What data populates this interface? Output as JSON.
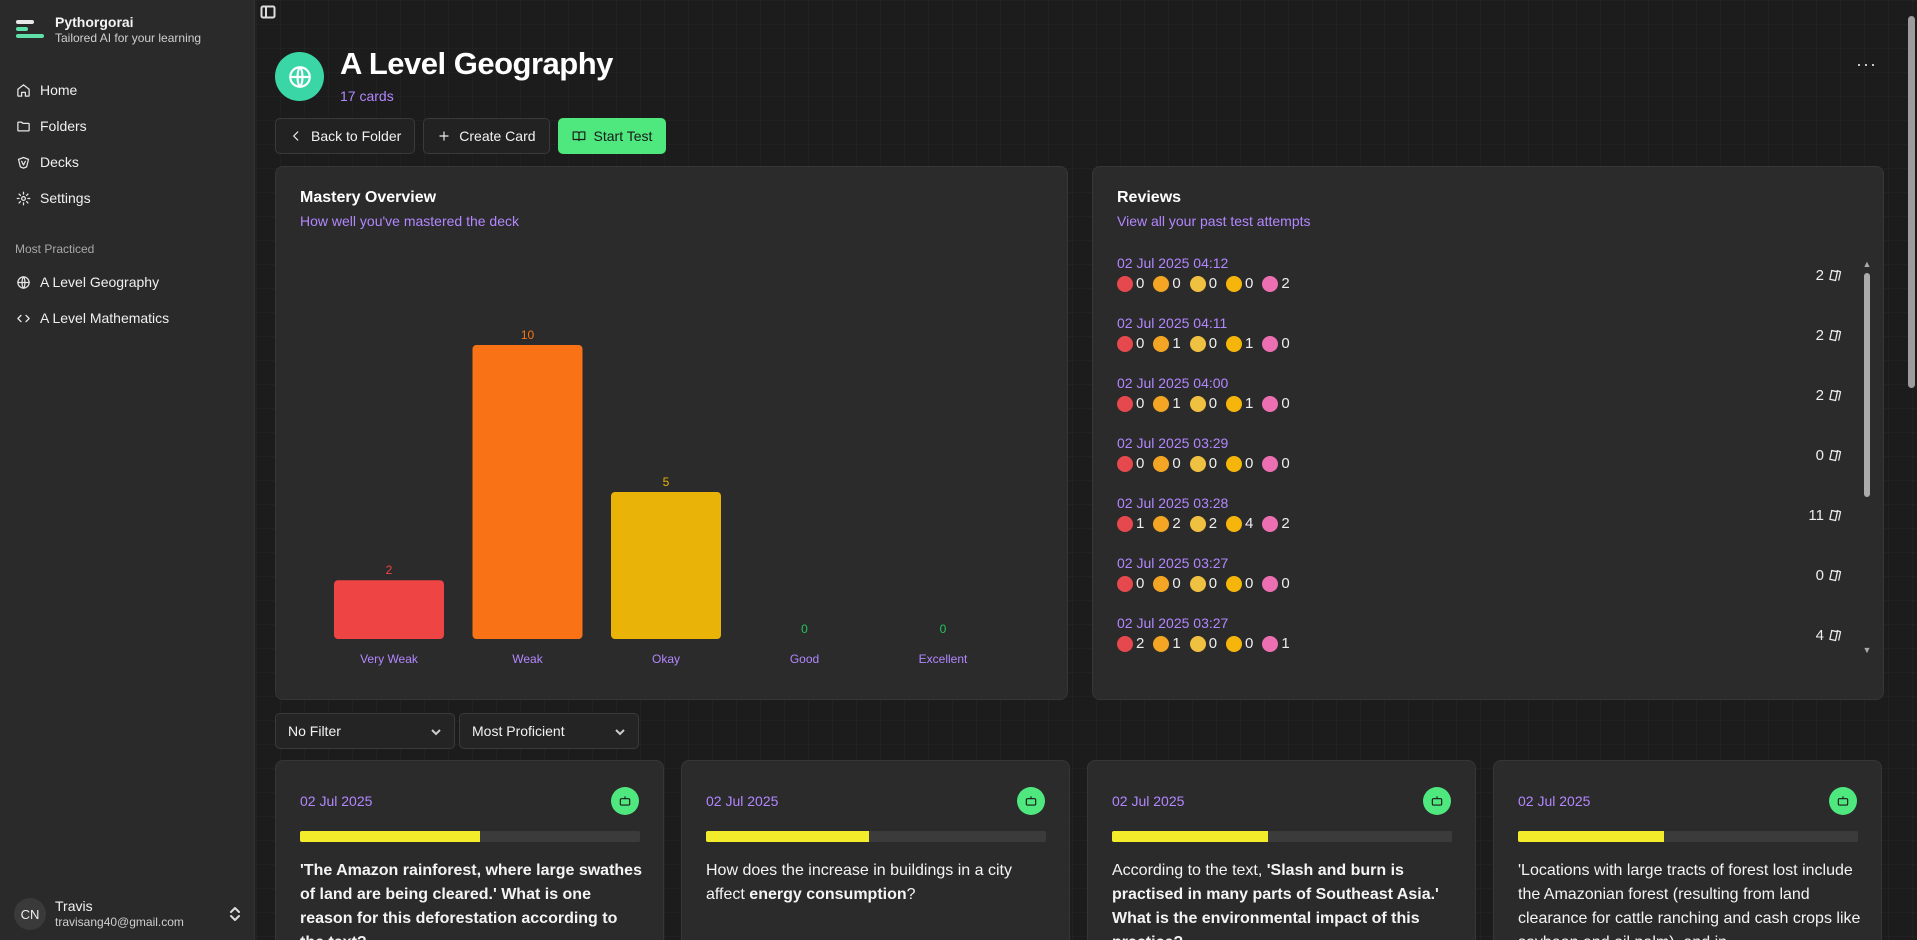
{
  "brand": {
    "name": "Pythorgorai",
    "tagline": "Tailored AI for your learning"
  },
  "nav": [
    {
      "label": "Home",
      "icon": "home-icon"
    },
    {
      "label": "Folders",
      "icon": "folder-icon"
    },
    {
      "label": "Decks",
      "icon": "decks-icon"
    },
    {
      "label": "Settings",
      "icon": "gear-icon"
    }
  ],
  "most_practiced": {
    "label": "Most Practiced",
    "items": [
      {
        "label": "A Level Geography",
        "icon": "globe-icon"
      },
      {
        "label": "A Level Mathematics",
        "icon": "code-icon"
      }
    ]
  },
  "user": {
    "initials": "CN",
    "name": "Travis",
    "email": "travisang40@gmail.com"
  },
  "header": {
    "title": "A Level Geography",
    "subtitle": "17 cards",
    "more": "···"
  },
  "actions": {
    "back": "Back to Folder",
    "create": "Create Card",
    "start": "Start Test"
  },
  "mastery": {
    "title": "Mastery Overview",
    "subtitle": "How well you've mastered the deck"
  },
  "chart_data": {
    "type": "bar",
    "categories": [
      "Very Weak",
      "Weak",
      "Okay",
      "Good",
      "Excellent"
    ],
    "values": [
      2,
      10,
      5,
      0,
      0
    ],
    "colors": [
      "#ef4444",
      "#f97316",
      "#eab308",
      "#22c55e",
      "#22c55e"
    ],
    "ylim": [
      0,
      10
    ]
  },
  "reviews": {
    "title": "Reviews",
    "subtitle": "View all your past test attempts",
    "items": [
      {
        "date": "02 Jul 2025 04:12",
        "counts": [
          0,
          0,
          0,
          0,
          2
        ],
        "total": "2"
      },
      {
        "date": "02 Jul 2025 04:11",
        "counts": [
          0,
          1,
          0,
          1,
          0
        ],
        "total": "2"
      },
      {
        "date": "02 Jul 2025 04:00",
        "counts": [
          0,
          1,
          0,
          1,
          0
        ],
        "total": "2"
      },
      {
        "date": "02 Jul 2025 03:29",
        "counts": [
          0,
          0,
          0,
          0,
          0
        ],
        "total": "0"
      },
      {
        "date": "02 Jul 2025 03:28",
        "counts": [
          1,
          2,
          2,
          4,
          2
        ],
        "total": "11"
      },
      {
        "date": "02 Jul 2025 03:27",
        "counts": [
          0,
          0,
          0,
          0,
          0
        ],
        "total": "0"
      },
      {
        "date": "02 Jul 2025 03:27",
        "counts": [
          2,
          1,
          0,
          0,
          1
        ],
        "total": "4"
      }
    ],
    "emoji_colors": [
      "#e5484d",
      "#f5a524",
      "#f0c040",
      "#f5b50a",
      "#ec6fb2"
    ]
  },
  "filters": {
    "filter": "No Filter",
    "sort": "Most Proficient"
  },
  "flashcards": [
    {
      "date": "02 Jul 2025",
      "progress": 0.53,
      "segments": [
        {
          "t": "'The Amazon rainforest, where large swathes of land are being cleared.' What is one reason for this deforestation according to the text?",
          "b": true
        }
      ]
    },
    {
      "date": "02 Jul 2025",
      "progress": 0.48,
      "segments": [
        {
          "t": "How does the increase in buildings in a city affect ",
          "b": false
        },
        {
          "t": "energy consumption",
          "b": true
        },
        {
          "t": "?",
          "b": false
        }
      ]
    },
    {
      "date": "02 Jul 2025",
      "progress": 0.46,
      "segments": [
        {
          "t": "According to the text, ",
          "b": false
        },
        {
          "t": "'Slash and burn is practised in many parts of Southeast Asia.' What is the environmental impact of this practice?",
          "b": true
        }
      ]
    },
    {
      "date": "02 Jul 2025",
      "progress": 0.43,
      "segments": [
        {
          "t": "'Locations with large tracts of forest lost include the Amazonian forest (resulting from land clearance for cattle ranching and cash crops like soybean and oil palm), and in",
          "b": false
        }
      ]
    }
  ]
}
